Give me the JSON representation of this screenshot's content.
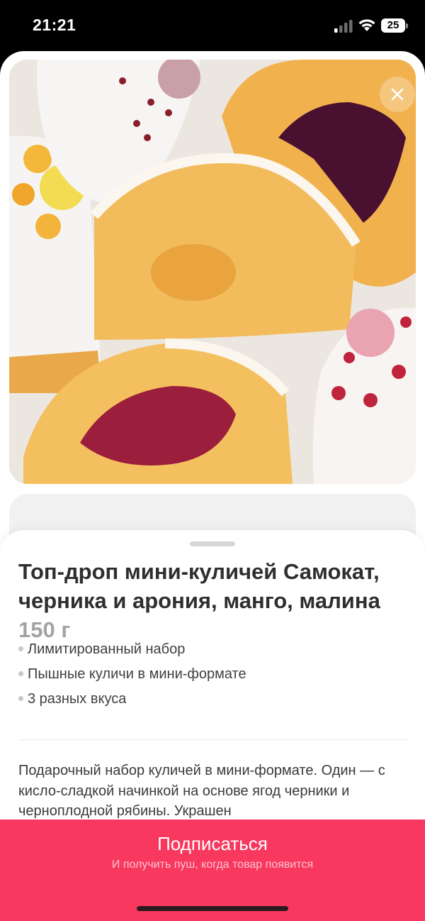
{
  "status_bar": {
    "time": "21:21",
    "battery": "25"
  },
  "product": {
    "title": "Топ-дроп мини-куличей Самокат, черника и арония, манго, малина",
    "weight": "150 г",
    "features": [
      "Лимитированный набор",
      "Пышные куличи в мини-формате",
      "3 разных вкуса"
    ],
    "description": "Подарочный набор куличей в мини-формате. Один — с кисло-сладкой начинкой на основе ягод черники и черноплодной рябины. Украшен"
  },
  "cta": {
    "label": "Подписаться",
    "sublabel": "И получить пуш, когда товар появится"
  },
  "colors": {
    "accent": "#f9385f",
    "title_text": "#2e2e2e",
    "weight_text": "#a3a3a3"
  },
  "icons": {
    "close": "close-icon",
    "signal": "cellular-signal-icon",
    "wifi": "wifi-icon",
    "battery": "battery-icon"
  }
}
